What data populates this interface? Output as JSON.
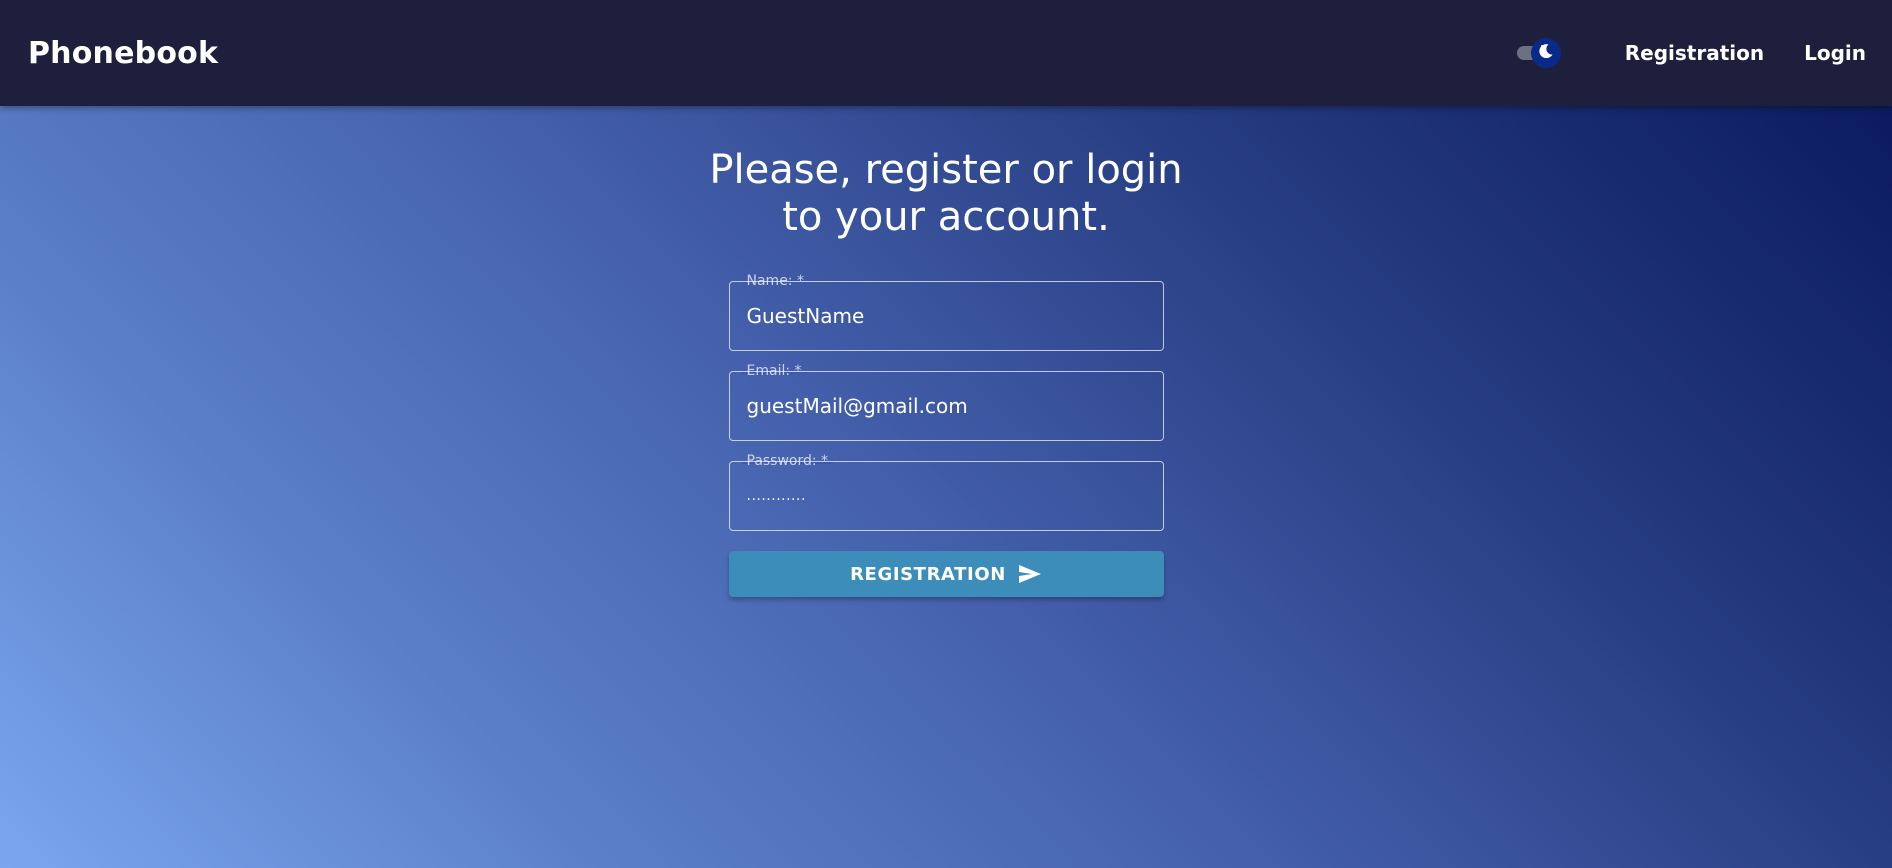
{
  "header": {
    "logo": "Phonebook",
    "theme_toggle": {
      "icon": "moon-icon",
      "state": "dark"
    },
    "nav": {
      "registration": "Registration",
      "login": "Login"
    }
  },
  "main": {
    "title_line1": "Please, register or login",
    "title_line2": "to your account.",
    "form": {
      "name": {
        "label": "Name: *",
        "value": "GuestName"
      },
      "email": {
        "label": "Email: *",
        "value": "guestMail@gmail.com"
      },
      "password": {
        "label": "Password: *",
        "value": "............"
      },
      "submit_label": "REGISTRATION",
      "submit_icon": "send-icon"
    }
  },
  "colors": {
    "header_bg": "#1d1f3d",
    "button_bg": "#3c8dba",
    "toggle_thumb": "#0a2a8a",
    "gradient_dark": "#08165a",
    "gradient_light": "#7aa6f0"
  }
}
